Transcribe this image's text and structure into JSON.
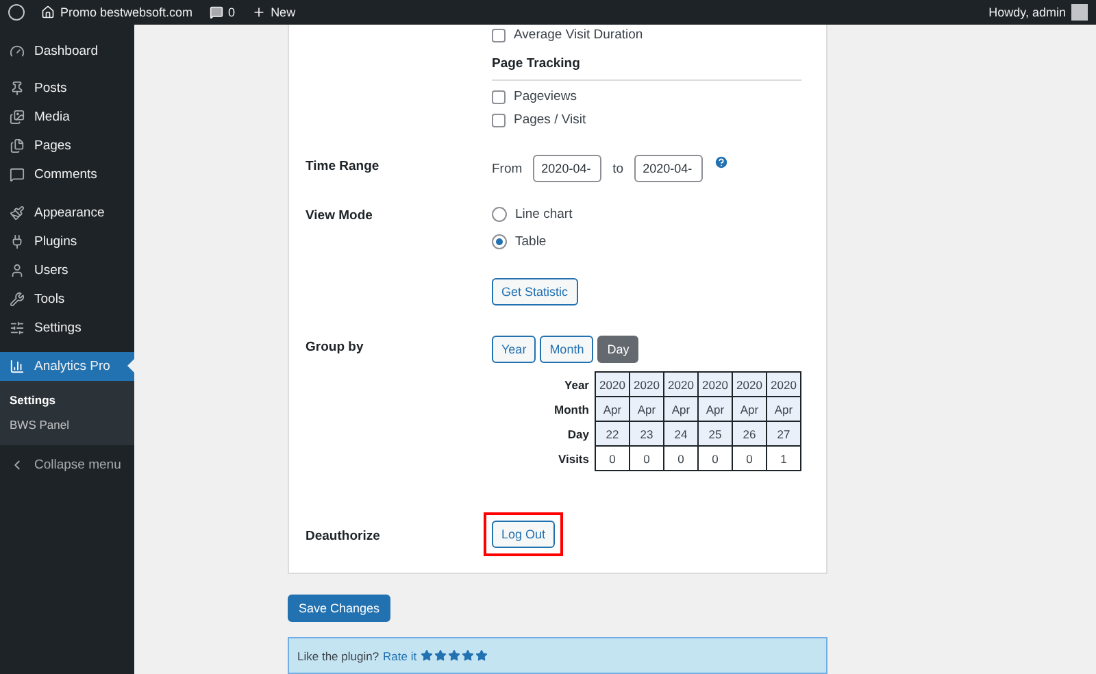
{
  "admin_bar": {
    "site": "Promo bestwebsoft.com",
    "comments": "0",
    "new": "New",
    "greeting": "Howdy, admin"
  },
  "sidebar": {
    "items": [
      {
        "label": "Dashboard",
        "selected": false
      },
      {
        "label": "Posts",
        "selected": false
      },
      {
        "label": "Media",
        "selected": false
      },
      {
        "label": "Pages",
        "selected": false
      },
      {
        "label": "Comments",
        "selected": false
      },
      {
        "label": "Appearance",
        "selected": false
      },
      {
        "label": "Plugins",
        "selected": false
      },
      {
        "label": "Users",
        "selected": false
      },
      {
        "label": "Tools",
        "selected": false
      },
      {
        "label": "Settings",
        "selected": false
      },
      {
        "label": "Analytics Pro",
        "selected": true,
        "children": [
          {
            "label": "Settings",
            "selected": true
          },
          {
            "label": "BWS Panel",
            "selected": false
          }
        ]
      }
    ],
    "collapse": "Collapse menu"
  },
  "metrics": {
    "options": [
      {
        "label": "Average Visit Duration",
        "checked": false
      }
    ],
    "page_tracking": {
      "title": "Page Tracking",
      "options": [
        {
          "label": "Pageviews",
          "checked": false
        },
        {
          "label": "Pages / Visit",
          "checked": false
        }
      ]
    }
  },
  "time_range": {
    "label": "Time Range",
    "from_label": "From",
    "from_value": "2020-04-",
    "to_label": "to",
    "to_value": "2020-04-"
  },
  "view_mode": {
    "label": "View Mode",
    "options": [
      {
        "label": "Line chart",
        "selected": false
      },
      {
        "label": "Table",
        "selected": true
      }
    ],
    "button": "Get Statistic"
  },
  "group_by": {
    "label": "Group by",
    "options": [
      {
        "label": "Year",
        "selected": false
      },
      {
        "label": "Month",
        "selected": false
      },
      {
        "label": "Day",
        "selected": true
      }
    ]
  },
  "table": {
    "rows": [
      {
        "header": "Year",
        "kind": "period",
        "cells": [
          "2020",
          "2020",
          "2020",
          "2020",
          "2020",
          "2020"
        ]
      },
      {
        "header": "Month",
        "kind": "period",
        "cells": [
          "Apr",
          "Apr",
          "Apr",
          "Apr",
          "Apr",
          "Apr"
        ]
      },
      {
        "header": "Day",
        "kind": "period",
        "cells": [
          "22",
          "23",
          "24",
          "25",
          "26",
          "27"
        ]
      },
      {
        "header": "Visits",
        "kind": "value",
        "cells": [
          "0",
          "0",
          "0",
          "0",
          "0",
          "1"
        ]
      }
    ]
  },
  "deauthorize": {
    "label": "Deauthorize",
    "button": "Log Out",
    "highlighted": true
  },
  "save_button": "Save Changes",
  "notice": {
    "text": "Like the plugin?",
    "link": "Rate it",
    "stars": 5
  }
}
